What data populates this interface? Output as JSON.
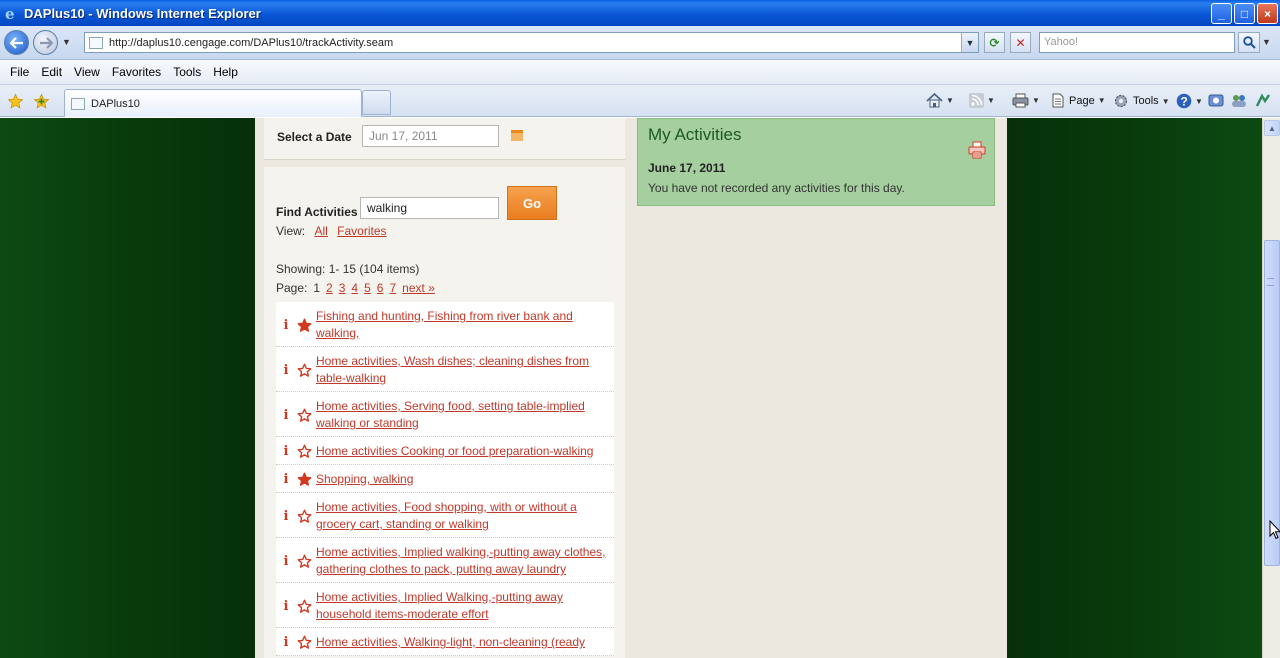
{
  "window": {
    "title": "DAPlus10 - Windows Internet Explorer",
    "controls": [
      "_",
      "□",
      "×"
    ]
  },
  "address_bar": {
    "url": "http://daplus10.cengage.com/DAPlus10/trackActivity.seam",
    "search_placeholder": "Yahoo!"
  },
  "menu": [
    "File",
    "Edit",
    "View",
    "Favorites",
    "Tools",
    "Help"
  ],
  "tab": {
    "label": "DAPlus10"
  },
  "command_bar": {
    "page_label": "Page",
    "tools_label": "Tools"
  },
  "date_panel": {
    "label": "Select a Date",
    "value": "Jun 17, 2011"
  },
  "find_panel": {
    "label": "Find Activities",
    "query": "walking",
    "go_label": "Go",
    "view_label": "View:",
    "view_all": "All",
    "view_favorites": "Favorites",
    "showing": "Showing: 1- 15 (104 items)",
    "page_label": "Page:",
    "current_page": "1",
    "pages": [
      "2",
      "3",
      "4",
      "5",
      "6",
      "7"
    ],
    "next_label": "next »"
  },
  "activities": [
    {
      "info": "i",
      "favorite": true,
      "label": "Fishing and hunting, Fishing from river bank and walking,"
    },
    {
      "info": "i",
      "favorite": false,
      "label": "Home activities, Wash dishes; cleaning dishes from table-walking"
    },
    {
      "info": "i",
      "favorite": false,
      "label": "Home activities, Serving food, setting table-implied walking or standing"
    },
    {
      "info": "i",
      "favorite": false,
      "label": "Home activities Cooking or food preparation-walking"
    },
    {
      "info": "i",
      "favorite": true,
      "label": "Shopping, walking"
    },
    {
      "info": "i",
      "favorite": false,
      "label": "Home activities, Food shopping, with or without a grocery cart, standing or walking"
    },
    {
      "info": "i",
      "favorite": false,
      "label": "Home activities, Implied walking,-putting away clothes, gathering clothes to pack, putting away laundry"
    },
    {
      "info": "i",
      "favorite": false,
      "label": "Home activities, Implied Walking,-putting away household items-moderate effort"
    },
    {
      "info": "i",
      "favorite": false,
      "label": "Home activities, Walking-light, non-cleaning (ready"
    }
  ],
  "my_activities": {
    "title": "My Activities",
    "date": "June 17, 2011",
    "message": "You have not recorded any activities for this day."
  },
  "colors": {
    "accent": "#c0392b",
    "go_button": "#ea7d1f",
    "my_activities_bg": "#a5cf9f",
    "page_background": "#06300a"
  }
}
